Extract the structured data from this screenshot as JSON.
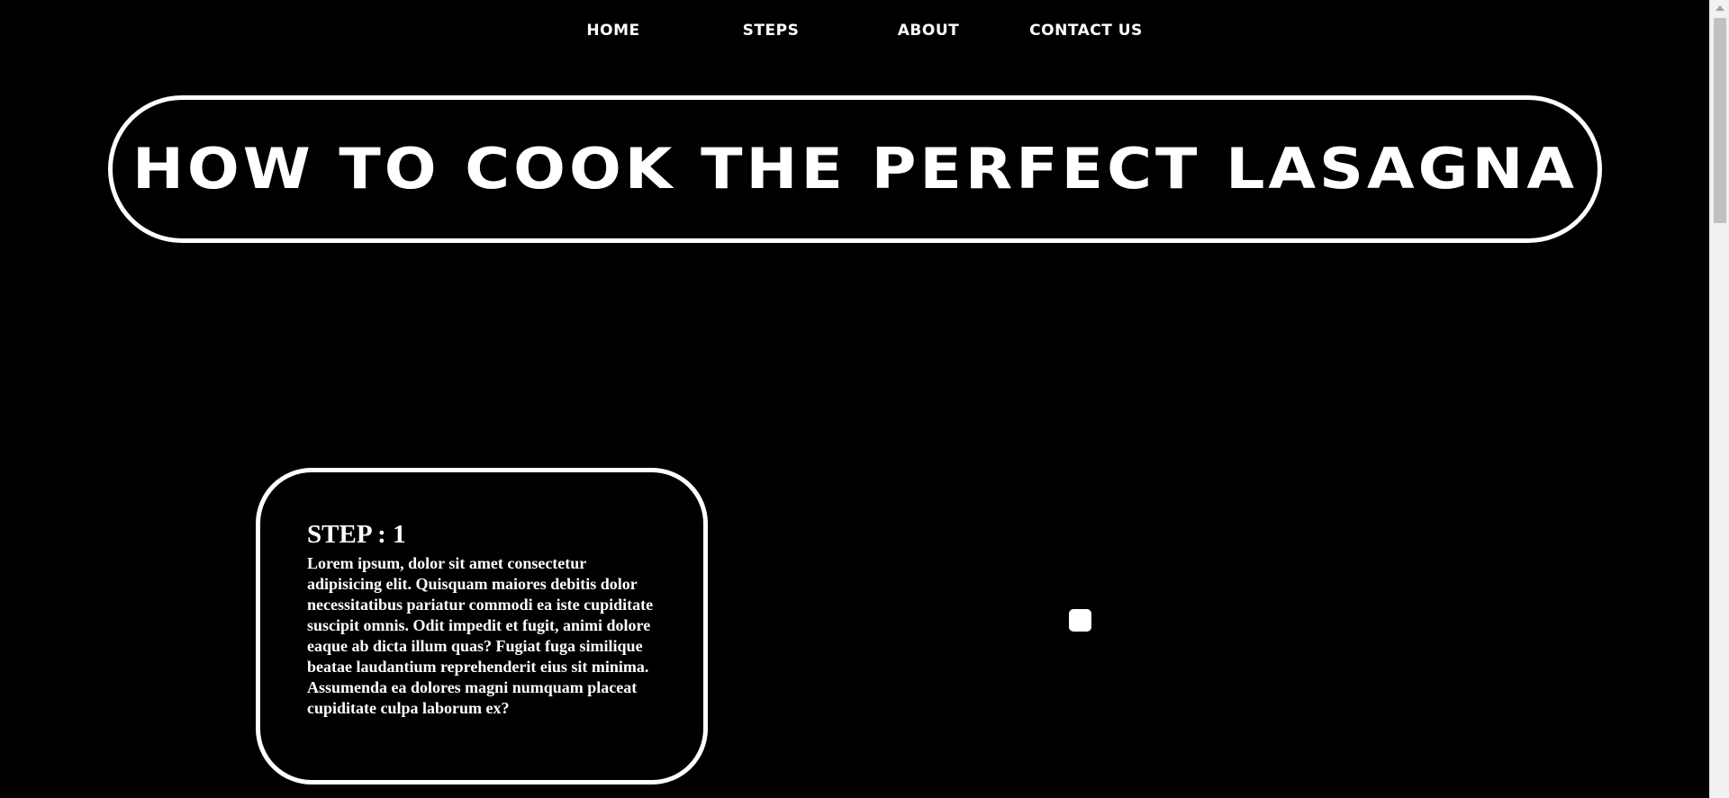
{
  "nav": {
    "items": [
      {
        "label": "HOME"
      },
      {
        "label": "STEPS"
      },
      {
        "label": "ABOUT"
      },
      {
        "label": "CONTACT US"
      }
    ]
  },
  "hero": {
    "title": "HOW TO COOK THE PERFECT LASAGNA"
  },
  "step_card": {
    "title": "STEP : 1",
    "body": "Lorem ipsum, dolor sit amet consectetur adipisicing elit. Quisquam maiores debitis dolor necessitatibus pariatur commodi ea iste cupiditate suscipit omnis. Odit impedit et fugit, animi dolore eaque ab dicta illum quas? Fugiat fuga similique beatae laudantium reprehenderit eius sit minima. Assumenda ea dolores magni numquam placeat cupiditate culpa laborum ex?"
  },
  "colors": {
    "background": "#000000",
    "foreground": "#ffffff"
  }
}
